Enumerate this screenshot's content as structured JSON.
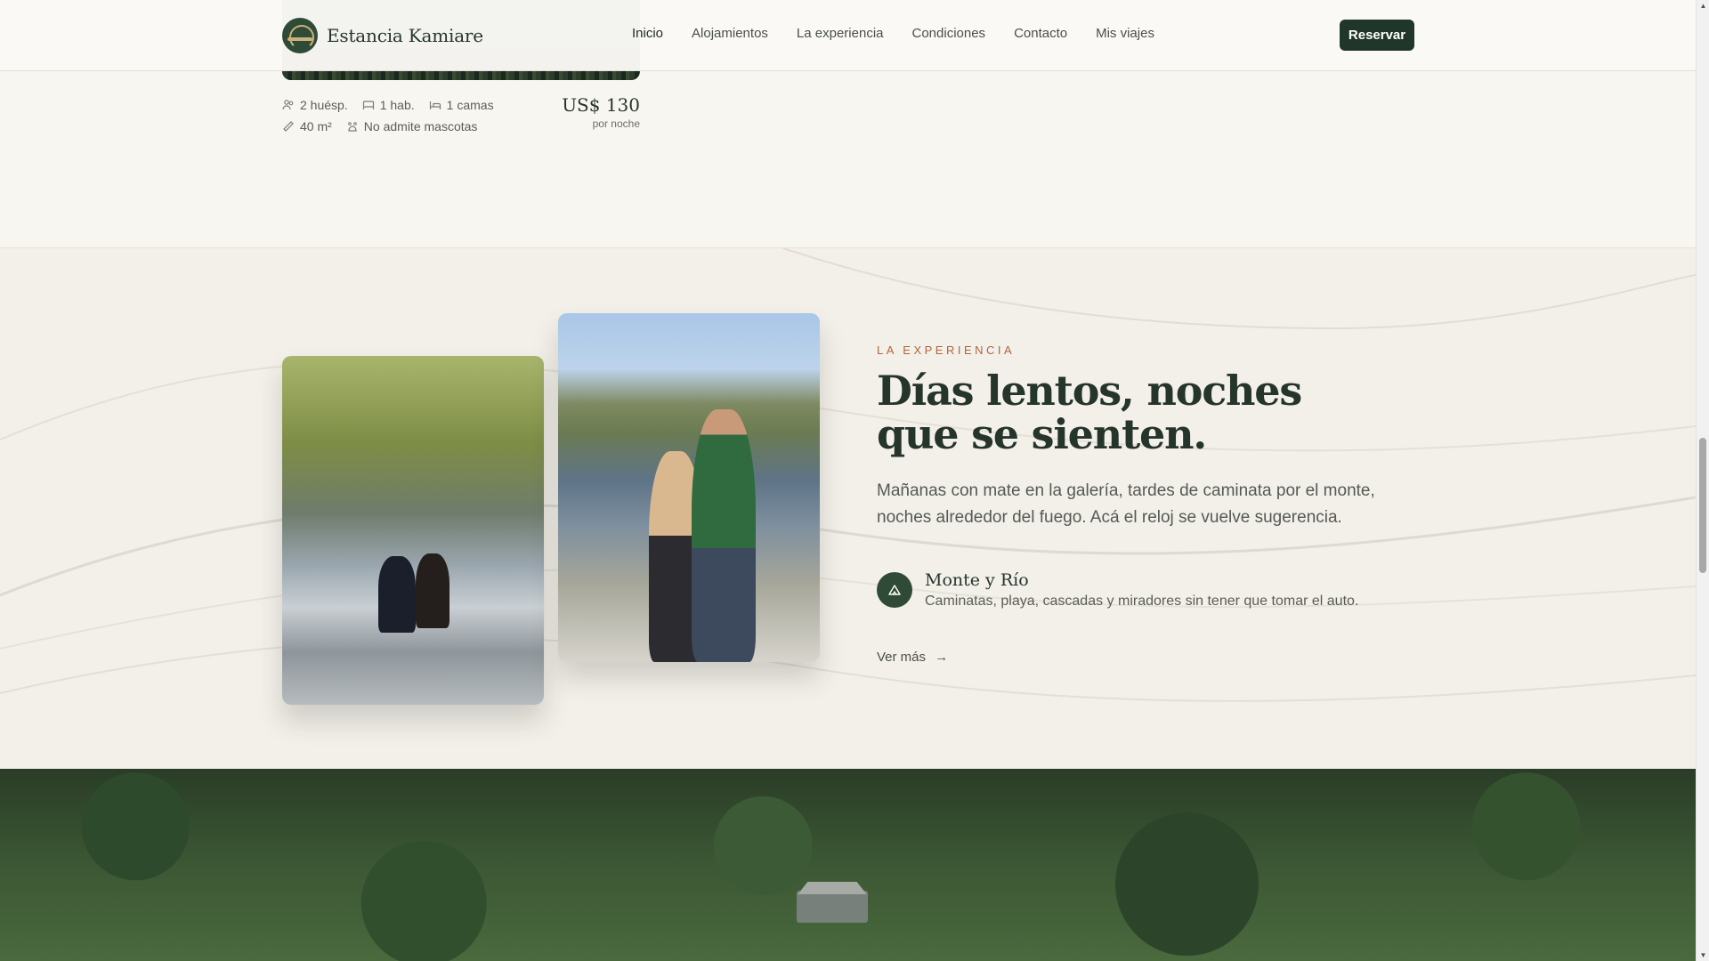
{
  "brand": {
    "name": "Estancia Kamiare"
  },
  "nav": {
    "items": [
      "Inicio",
      "Alojamientos",
      "La experiencia",
      "Condiciones",
      "Contacto",
      "Mis viajes"
    ],
    "cta": "Reservar"
  },
  "listing": {
    "guests": "2 huésp.",
    "rooms": "1 hab.",
    "beds": "1 camas",
    "area": "40 m²",
    "pets": "No admite mascotas",
    "price": "US$ 130",
    "price_unit": "por noche"
  },
  "experience": {
    "eyebrow": "LA EXPERIENCIA",
    "heading_line1": "Días lentos, noches",
    "heading_line2": "que se sienten.",
    "lead": "Mañanas con mate en la galería, tardes de caminata por el monte, noches alrededor del fuego. Acá el reloj se vuelve sugerencia.",
    "feature_title": "Monte y Río",
    "feature_desc": "Caminatas, playa, cascadas y miradores sin tener que tomar el auto.",
    "more_link": "Ver más",
    "more_arrow": "→"
  },
  "icons": {
    "feature": "mountain-icon"
  },
  "colors": {
    "brand_dark": "#21362a",
    "accent": "#b2643f",
    "background": "#f8f6f1",
    "section_bg": "#f3f0ea"
  }
}
